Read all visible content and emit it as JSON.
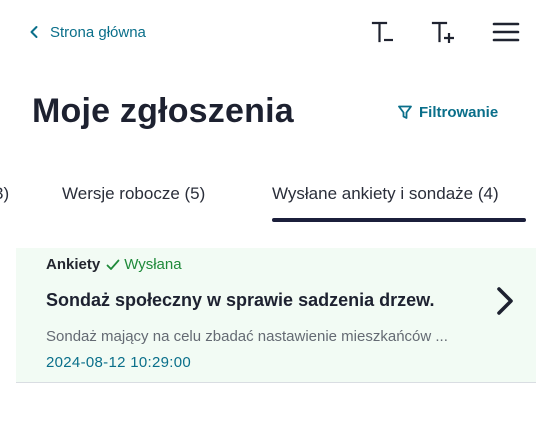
{
  "header": {
    "back_label": "Strona główna",
    "decrease_text_label": "T-",
    "increase_text_label": "T+"
  },
  "page": {
    "title": "Moje zgłoszenia",
    "filter_label": "Filtrowanie"
  },
  "tabs": [
    {
      "label": "3)",
      "active": false
    },
    {
      "label": "Wersje robocze (5)",
      "active": false
    },
    {
      "label": "Wysłane ankiety i sondaże (4)",
      "active": true
    }
  ],
  "items": [
    {
      "category": "Ankiety",
      "status": "Wysłana",
      "title": "Sondaż społeczny w sprawie sadzenia drzew.",
      "description": "Sondaż mający na celu zbadać nastawienie mieszkańców ...",
      "date": "2024-08-12 10:29:00"
    }
  ],
  "colors": {
    "accent": "#0a6f8a",
    "success": "#1f8a3a",
    "card_bg": "#f2fbf4",
    "tab_indicator": "#1b1f3b"
  },
  "icons": {
    "back": "chevron-left-icon",
    "decrease_text": "text-decrease-icon",
    "increase_text": "text-increase-icon",
    "menu": "hamburger-menu-icon",
    "filter": "filter-icon",
    "status": "checkmark-icon",
    "open_item": "chevron-right-icon"
  }
}
